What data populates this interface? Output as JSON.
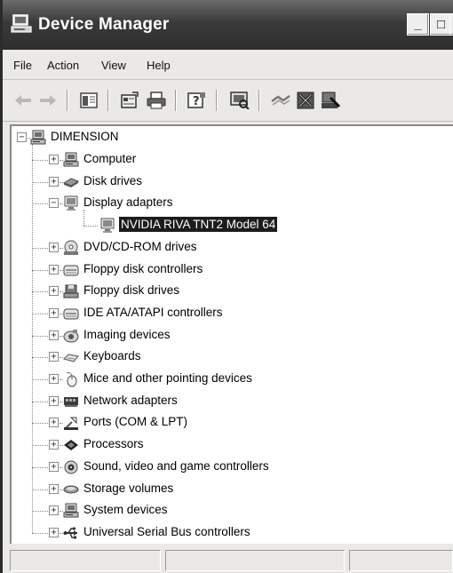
{
  "window": {
    "title": "Device Manager",
    "buttons": {
      "minimize": "_",
      "maximize": "□",
      "close": "×"
    }
  },
  "menu": [
    "File",
    "Action",
    "View",
    "Help"
  ],
  "toolbar": [
    "back-arrow-icon",
    "forward-arrow-icon",
    "show-hide-console-tree-icon",
    "properties-icon",
    "print-icon",
    "help-icon",
    "scan-hardware-icon",
    "update-driver-icon",
    "uninstall-icon",
    "disable-device-icon"
  ],
  "tree": {
    "root": {
      "label": "DIMENSION",
      "icon": "computer-icon",
      "expanded": true
    },
    "categories": [
      {
        "label": "Computer",
        "icon": "computer-icon",
        "expanded": false
      },
      {
        "label": "Disk drives",
        "icon": "disk-drive-icon",
        "expanded": false
      },
      {
        "label": "Display adapters",
        "icon": "monitor-icon",
        "expanded": true,
        "children": [
          {
            "label": "NVIDIA RIVA TNT2 Model 64",
            "icon": "monitor-icon",
            "selected": true
          }
        ]
      },
      {
        "label": "DVD/CD-ROM drives",
        "icon": "cd-drive-icon",
        "expanded": false
      },
      {
        "label": "Floppy disk controllers",
        "icon": "controller-icon",
        "expanded": false
      },
      {
        "label": "Floppy disk drives",
        "icon": "floppy-drive-icon",
        "expanded": false
      },
      {
        "label": "IDE ATA/ATAPI controllers",
        "icon": "controller-icon",
        "expanded": false
      },
      {
        "label": "Imaging devices",
        "icon": "camera-icon",
        "expanded": false
      },
      {
        "label": "Keyboards",
        "icon": "keyboard-icon",
        "expanded": false
      },
      {
        "label": "Mice and other pointing devices",
        "icon": "mouse-icon",
        "expanded": false
      },
      {
        "label": "Network adapters",
        "icon": "network-adapter-icon",
        "expanded": false
      },
      {
        "label": "Ports (COM & LPT)",
        "icon": "port-icon",
        "expanded": false
      },
      {
        "label": "Processors",
        "icon": "processor-icon",
        "expanded": false
      },
      {
        "label": "Sound, video and game controllers",
        "icon": "sound-icon",
        "expanded": false
      },
      {
        "label": "Storage volumes",
        "icon": "storage-volume-icon",
        "expanded": false
      },
      {
        "label": "System devices",
        "icon": "computer-icon",
        "expanded": false
      },
      {
        "label": "Universal Serial Bus controllers",
        "icon": "usb-icon",
        "expanded": false
      }
    ]
  },
  "statusbar": [
    "",
    "",
    ""
  ],
  "colors": {
    "titlebar": "#2e2e2e",
    "selection": "#1c1c1c",
    "chrome": "#ebe9e6"
  }
}
